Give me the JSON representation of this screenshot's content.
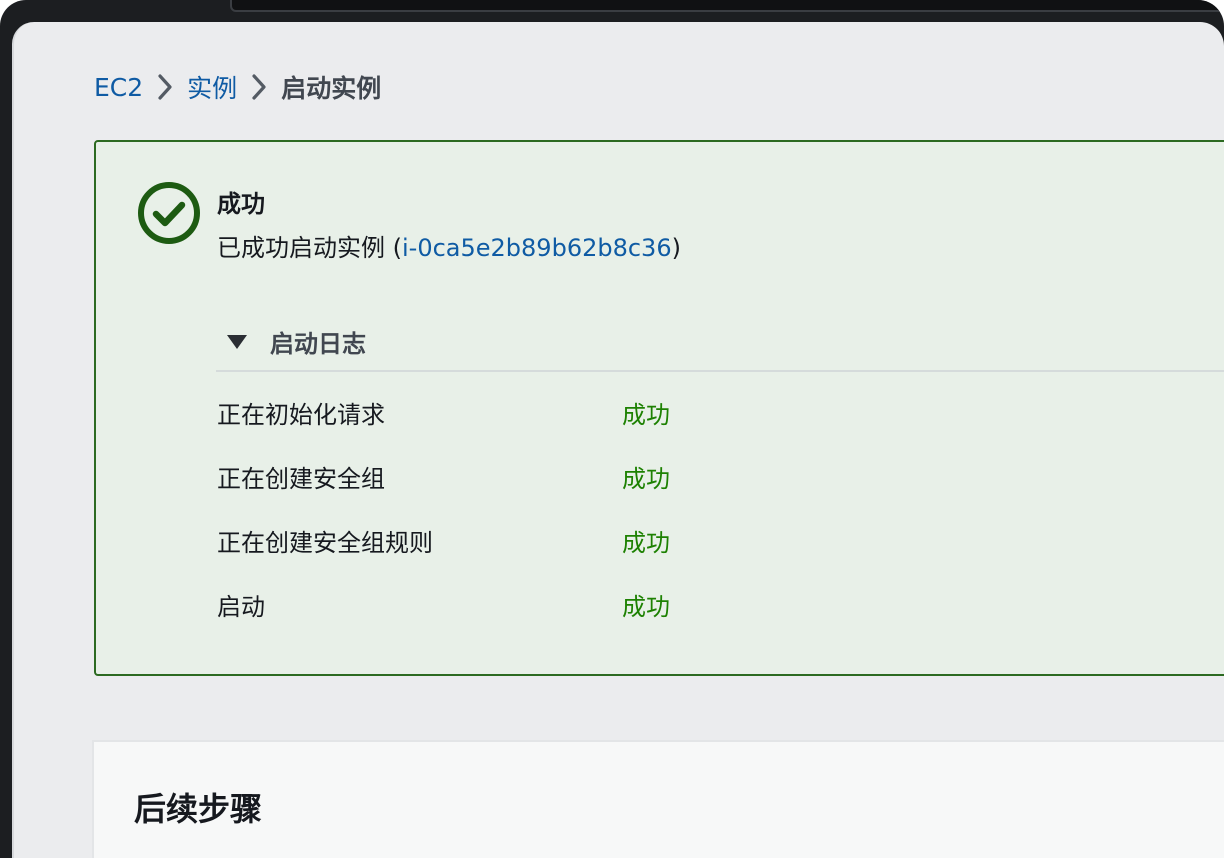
{
  "breadcrumb": {
    "items": [
      {
        "label": "EC2"
      },
      {
        "label": "实例"
      },
      {
        "label": "启动实例"
      }
    ],
    "separator_icon": "chevron-right-icon"
  },
  "flash": {
    "icon": "check-circle-icon",
    "title": "成功",
    "message_prefix": "已成功启动实例 (",
    "instance_id": "i-0ca5e2b89b62b8c36",
    "message_suffix": ")",
    "colors": {
      "border": "#2c6a21",
      "background": "#e8f0e8",
      "status": "#1d8102",
      "link": "#0f5ba4"
    }
  },
  "launch_log": {
    "toggle_icon": "caret-down-icon",
    "label": "启动日志",
    "rows": [
      {
        "step": "正在初始化请求",
        "status": "成功"
      },
      {
        "step": "正在创建安全组",
        "status": "成功"
      },
      {
        "step": "正在创建安全组规则",
        "status": "成功"
      },
      {
        "step": "启动",
        "status": "成功"
      }
    ]
  },
  "next_steps": {
    "title": "后续步骤"
  }
}
